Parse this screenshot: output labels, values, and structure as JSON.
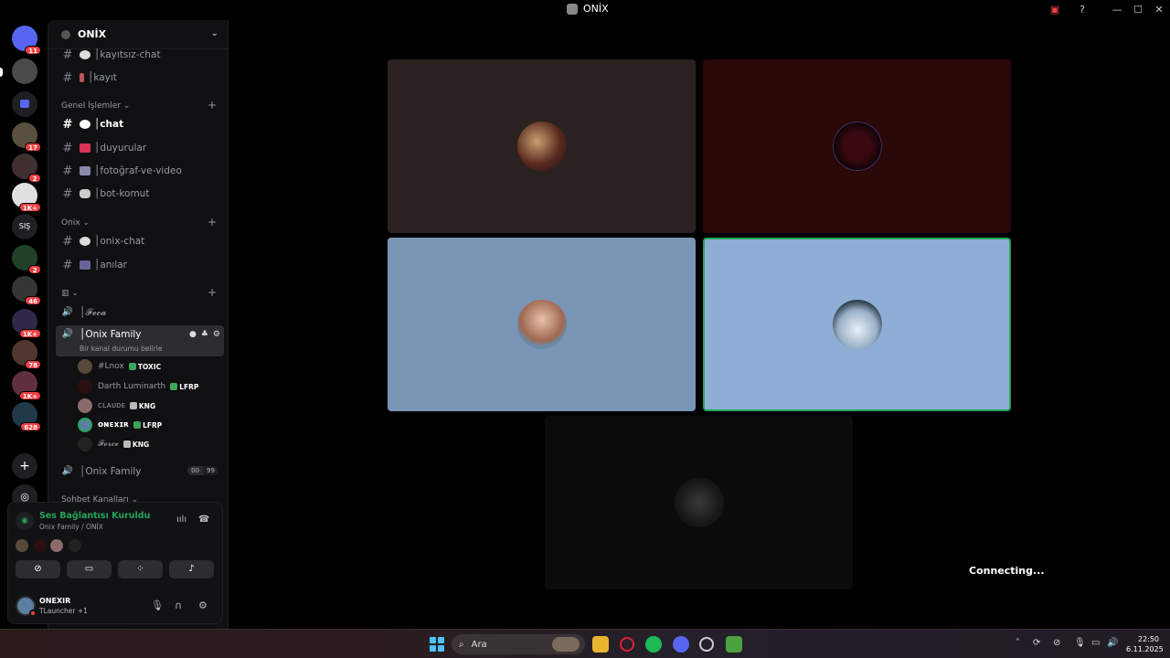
{
  "window": {
    "title": "ONİX"
  },
  "rail": {
    "badges": [
      "11",
      "17",
      "2",
      "1K+",
      "2",
      "46",
      "1K+",
      "78",
      "1K+",
      "628"
    ],
    "short_name": "SIŞ"
  },
  "guild": {
    "name": "ONİX"
  },
  "channels_top": [
    {
      "label": "│kayıtsız-chat"
    },
    {
      "label": "│kayıt"
    }
  ],
  "categories": {
    "genel": "Genel İşlemler",
    "onix": "Onix"
  },
  "genel_channels": [
    {
      "label": "│chat"
    },
    {
      "label": "│duyurular"
    },
    {
      "label": "│fotoğraf-ve-video"
    },
    {
      "label": "│bot-komut"
    }
  ],
  "onix_channels": [
    {
      "label": "│onix-chat"
    },
    {
      "label": "│anılar"
    }
  ],
  "voice": {
    "channel_1": "│𝓕𝓮𝓬𝓪",
    "channel_selected": "│Onix Family",
    "status_placeholder": "Bir kanal durumu belirle",
    "channel_3": "│Onix Family",
    "counter_a": "00",
    "counter_b": "99",
    "members": [
      {
        "name": "#Lnox",
        "tag": "TOXIC"
      },
      {
        "name": "Darth Luminarth",
        "tag": "LFRP"
      },
      {
        "name": "ᴄʟᴀᴜᴅᴇ",
        "tag": "KNG"
      },
      {
        "name": "ᴏɴᴇxɪʀ",
        "tag": "LFRP"
      },
      {
        "name": "𝓕𝓸𝓻𝓬𝓮",
        "tag": "KNG"
      }
    ],
    "next_category": "Sohbet Kanalları"
  },
  "voice_panel": {
    "status": "Ses Bağlantısı Kuruldu",
    "location": "Onix Family / ONİX"
  },
  "user": {
    "name": "ONEXIR",
    "activity": "TLauncher +1"
  },
  "stage": {
    "connecting": "Connecting..."
  },
  "taskbar": {
    "search": "Ara",
    "time": "22:50",
    "date": "6.11.2025"
  },
  "colors": {
    "accent_green": "#23a55a",
    "badge_red": "#f23f43"
  }
}
